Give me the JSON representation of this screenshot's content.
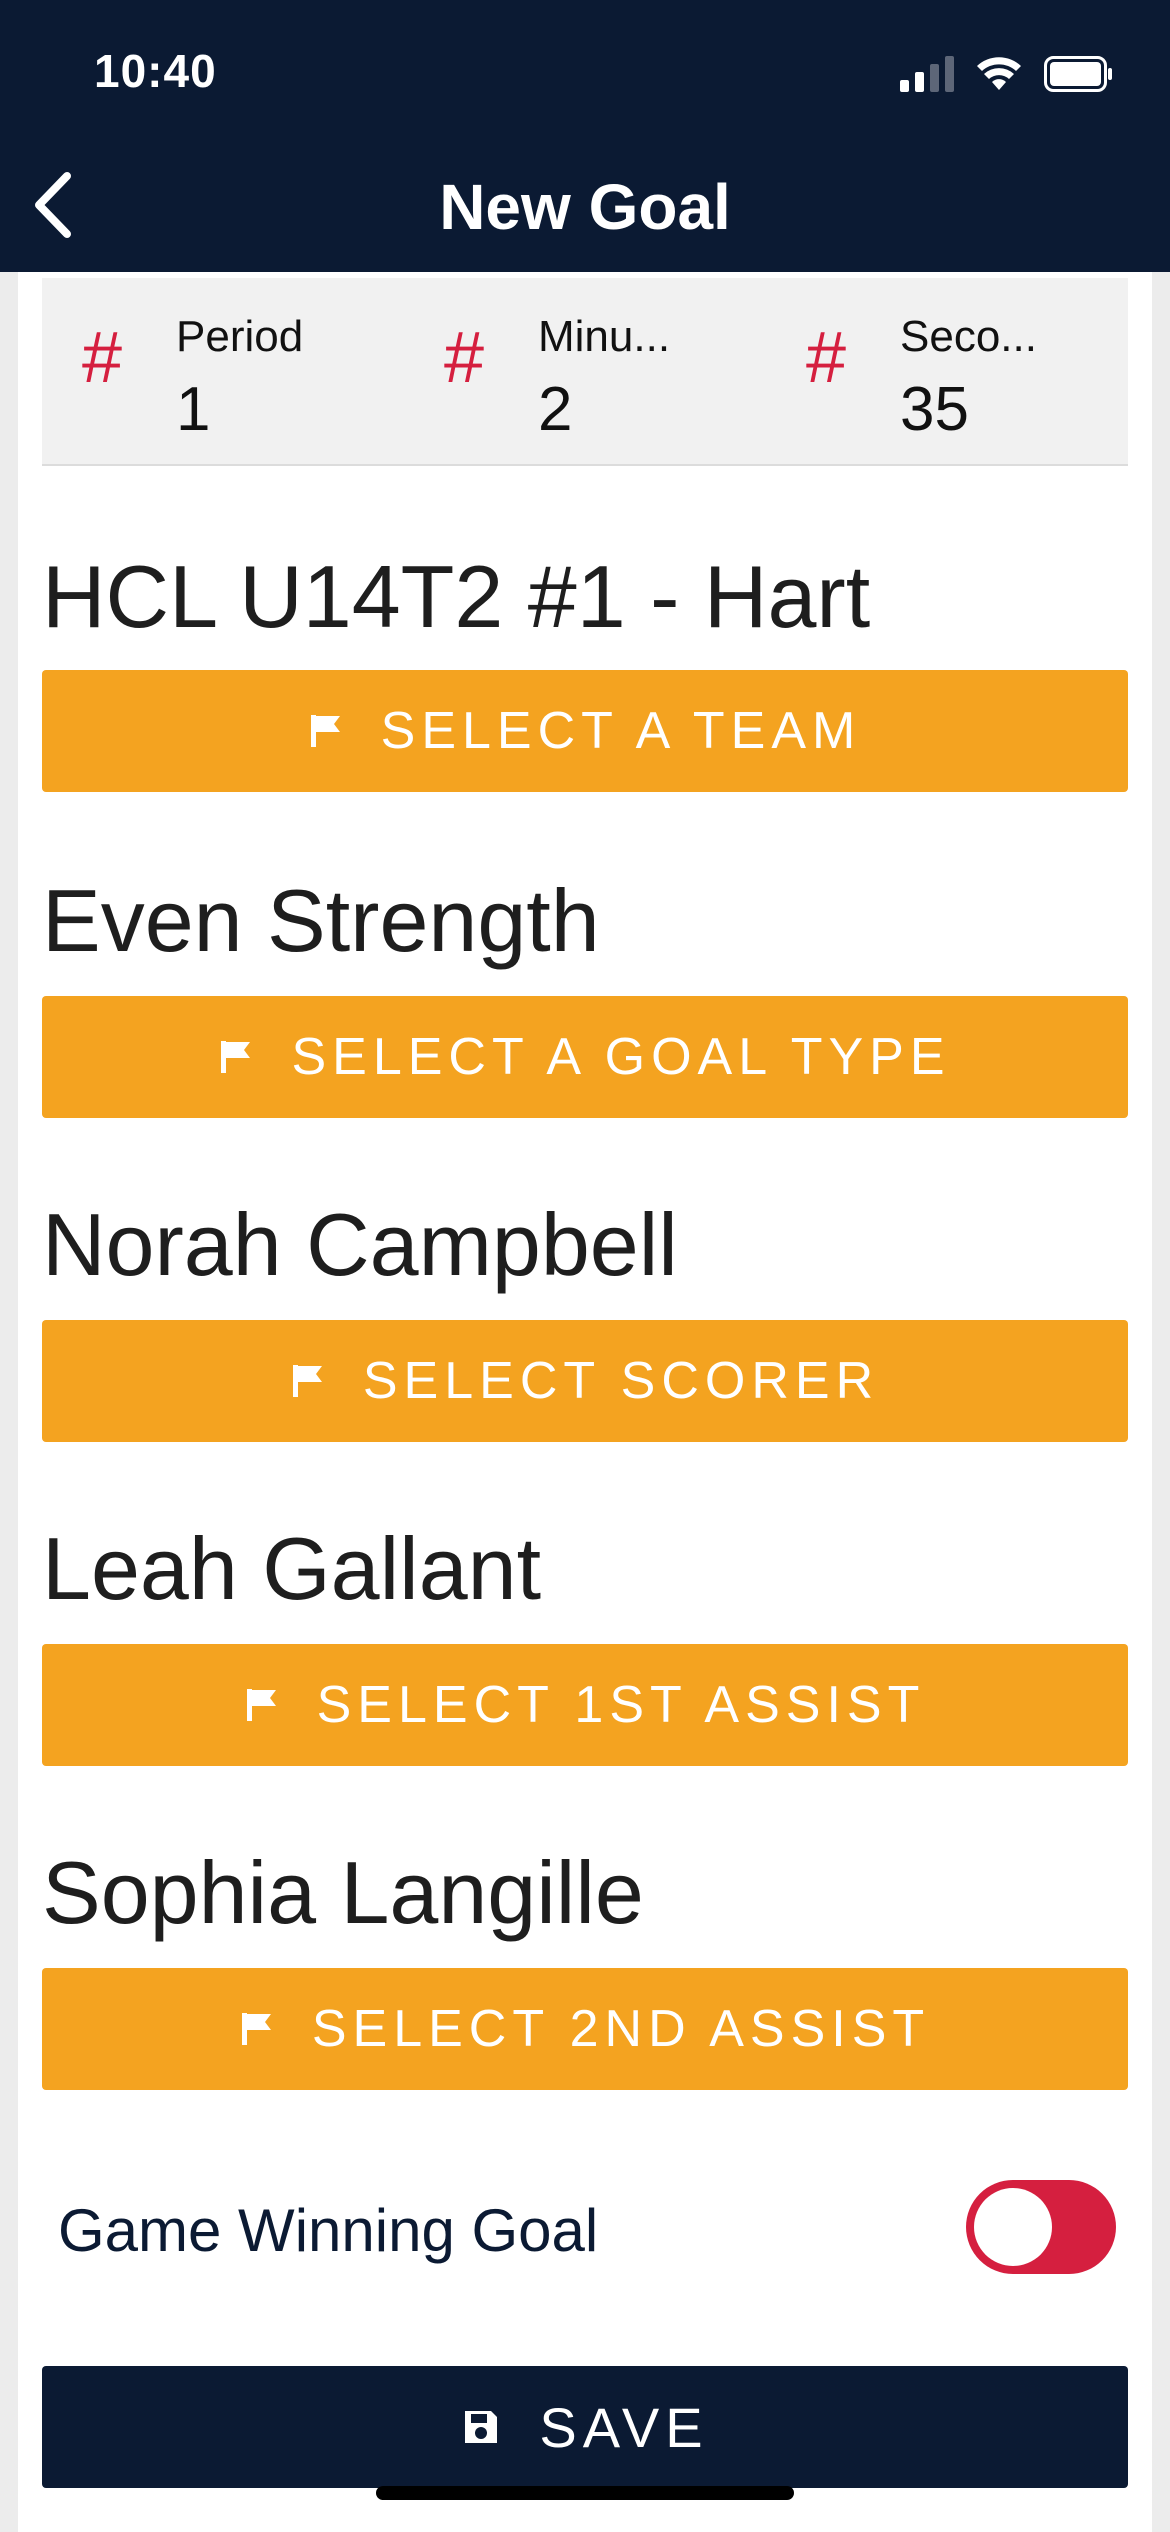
{
  "status_bar": {
    "time": "10:40"
  },
  "nav": {
    "title": "New Goal"
  },
  "time_fields": [
    {
      "label": "Period",
      "value": "1"
    },
    {
      "label": "Minu...",
      "value": "2"
    },
    {
      "label": "Seco...",
      "value": "35"
    }
  ],
  "sections": {
    "team": {
      "value": "HCL U14T2 #1 - Hart",
      "button": "SELECT A TEAM"
    },
    "goal_type": {
      "value": "Even Strength",
      "button": "SELECT A GOAL TYPE"
    },
    "scorer": {
      "value": "Norah Campbell",
      "button": "SELECT SCORER"
    },
    "assist1": {
      "value": "Leah Gallant",
      "button": "SELECT 1ST ASSIST"
    },
    "assist2": {
      "value": "Sophia Langille",
      "button": "SELECT 2ND ASSIST"
    }
  },
  "game_winning_goal": {
    "label": "Game Winning Goal",
    "enabled": false
  },
  "save": {
    "label": "SAVE"
  },
  "colors": {
    "header": "#0b1a33",
    "accent_button": "#f4a320",
    "hash_icon": "#d51f3f",
    "toggle": "#d51f3f",
    "save_button": "#0b1a33"
  },
  "icons": {
    "back": "chevron-left-icon",
    "field": "hash-icon",
    "select": "flag-icon",
    "save": "floppy-disk-icon"
  }
}
